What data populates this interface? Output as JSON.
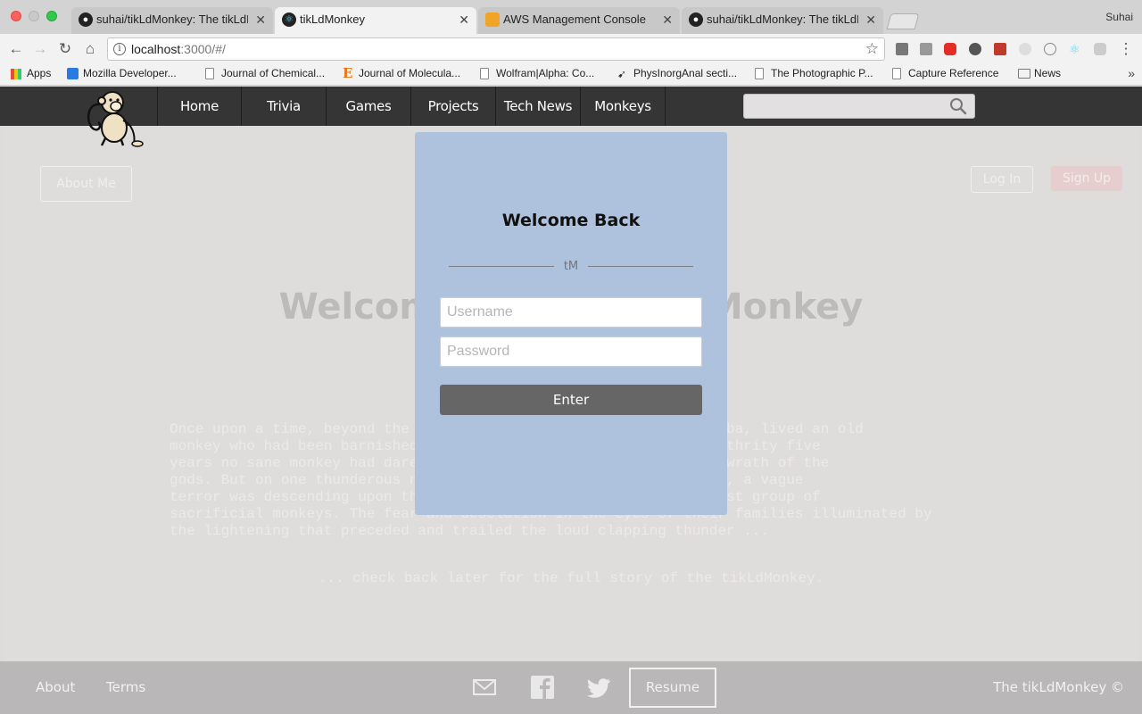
{
  "browser": {
    "profile_name": "Suhai",
    "tabs": [
      {
        "title": "suhai/tikLdMonkey: The tikLdM",
        "icon": "github-icon",
        "active": false
      },
      {
        "title": "tikLdMonkey",
        "icon": "react-icon",
        "active": true
      },
      {
        "title": "AWS Management Console",
        "icon": "aws-cube-icon",
        "active": false
      },
      {
        "title": "suhai/tikLdMonkey: The tikLdM",
        "icon": "github-icon",
        "active": false
      }
    ],
    "url_host": "localhost",
    "url_rest": ":3000/#/",
    "bookmarks": [
      {
        "label": "Apps",
        "icon": "apps-grid-icon"
      },
      {
        "label": "Mozilla Developer...",
        "icon": "mozilla-icon"
      },
      {
        "label": "Journal of Chemical...",
        "icon": "page-icon"
      },
      {
        "label": "Journal of Molecula...",
        "icon": "elsevier-icon"
      },
      {
        "label": "Wolfram|Alpha: Co...",
        "icon": "page-icon"
      },
      {
        "label": "PhysInorgAnal secti...",
        "icon": "bird-icon"
      },
      {
        "label": "The Photographic P...",
        "icon": "page-icon"
      },
      {
        "label": "Capture Reference",
        "icon": "page-icon"
      },
      {
        "label": "News",
        "icon": "folder-icon"
      }
    ],
    "colors": {
      "chrome": "#d3d3d3",
      "toolbar": "#f2f2f2"
    }
  },
  "site": {
    "nav": [
      "Home",
      "Trivia",
      "Games",
      "Projects",
      "Tech News",
      "Monkeys"
    ],
    "about_label": "About Me",
    "login_label": "Log In",
    "signup_label": "Sign Up",
    "hero_title": "Welcome to the tikLdMonkey",
    "story": "Once upon a time, beyond the mountains of the kingdom of Taabanirba, lived an old\nmonkey who had been barnished from the land. For two hundred and thrity five\nyears no sane monkey had dared to enter the land for fear of the wrath of the\ngods. But on one thunderous night of the hundredth lunar calendar, a vague\nterror was descending upon the land that was destined for the first group of\nsacrificial monkeys. The fear and desolation in the eyes of their families illuminated by\nthe lightening that preceded and trailed the loud clapping thunder ...",
    "story_end": "... check back later for the full story of the tikLdMonkey.",
    "colors": {
      "navbar": "#353535",
      "modal": "#aec1dd",
      "footer": "#b9b7b7"
    }
  },
  "modal": {
    "title": "Welcome Back",
    "divider_label": "tM",
    "username_placeholder": "Username",
    "password_placeholder": "Password",
    "enter_label": "Enter"
  },
  "footer": {
    "about": "About",
    "terms": "Terms",
    "resume": "Resume",
    "copyright": "The tikLdMonkey ©",
    "icons": [
      "mail-icon",
      "facebook-icon",
      "twitter-icon"
    ]
  }
}
